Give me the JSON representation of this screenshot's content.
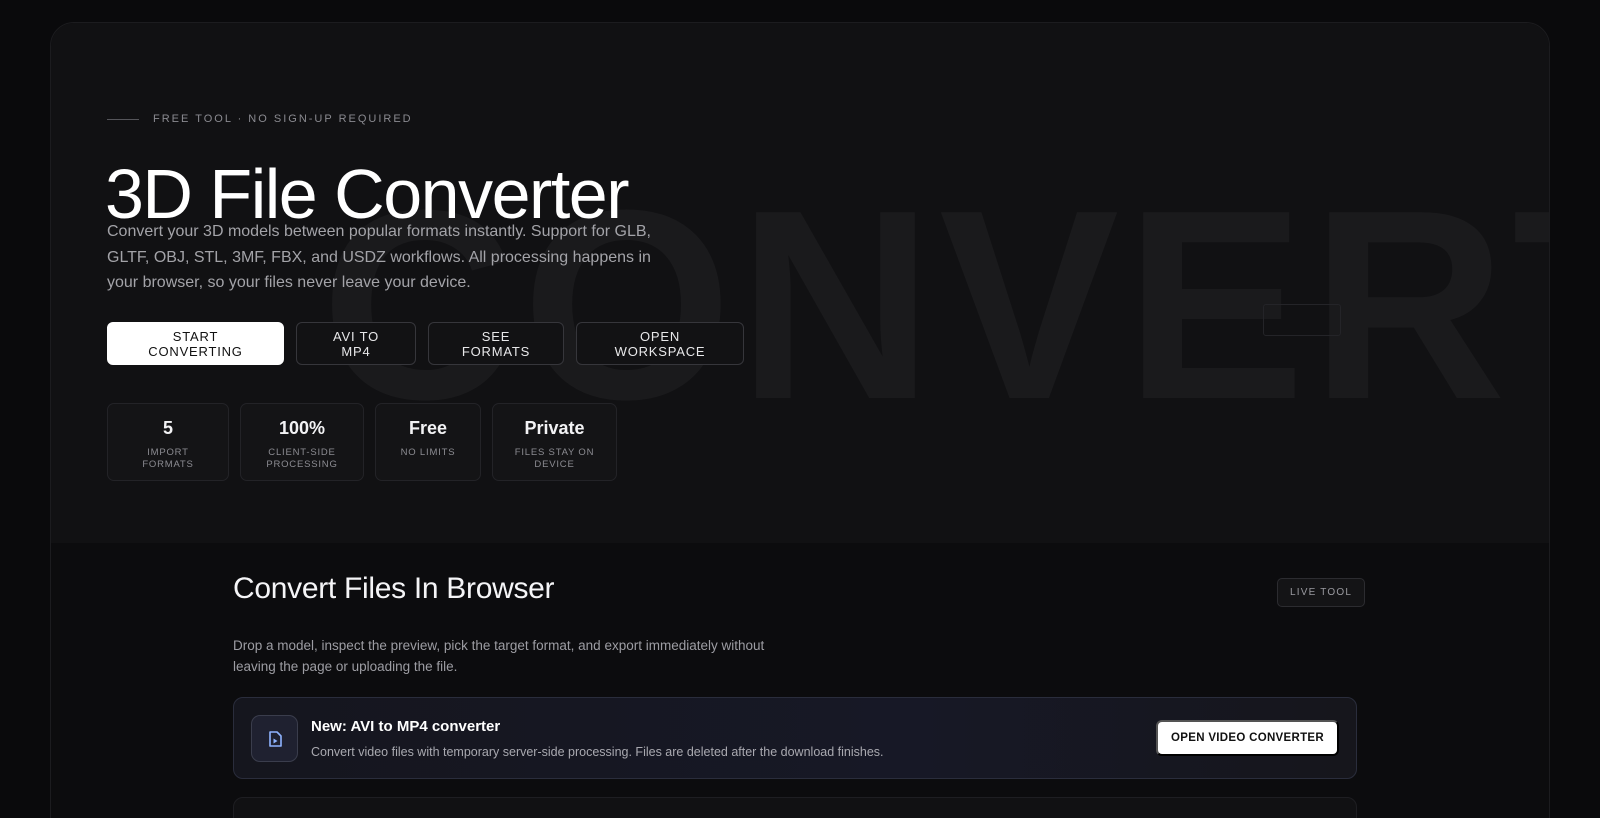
{
  "hero": {
    "background_word": "CONVERT",
    "eyebrow": "FREE TOOL · NO SIGN-UP REQUIRED",
    "title": "3D File Converter",
    "description": "Convert your 3D models between popular formats instantly. Support for GLB, GLTF, OBJ, STL, 3MF, FBX, and USDZ workflows. All processing happens in your browser, so your files never leave your device.",
    "buttons": [
      {
        "label": "START CONVERTING"
      },
      {
        "label": "AVI TO MP4"
      },
      {
        "label": "SEE FORMATS"
      },
      {
        "label": "OPEN WORKSPACE"
      }
    ],
    "stats": [
      {
        "value": "5",
        "label": "IMPORT FORMATS"
      },
      {
        "value": "100%",
        "label": "CLIENT-SIDE PROCESSING"
      },
      {
        "value": "Free",
        "label": "NO LIMITS"
      },
      {
        "value": "Private",
        "label": "FILES STAY ON DEVICE"
      }
    ]
  },
  "tool": {
    "title": "Convert Files In Browser",
    "badge": "LIVE TOOL",
    "description": "Drop a model, inspect the preview, pick the target format, and export immediately without leaving the page or uploading the file.",
    "banner": {
      "icon": "video-file-icon",
      "title": "New: AVI to MP4 converter",
      "description": "Convert video files with temporary server-side processing. Files are deleted after the download finishes.",
      "button": "OPEN VIDEO CONVERTER"
    }
  },
  "colors": {
    "page_bg": "#0a0a0c",
    "hero_bg": "#111113",
    "accent_icon": "#8fb4ff"
  }
}
